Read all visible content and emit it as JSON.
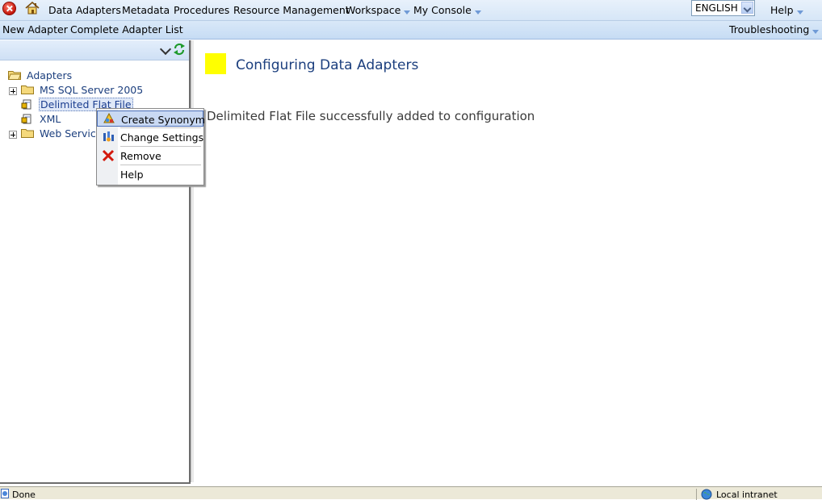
{
  "menubar": {
    "items": [
      {
        "label": "Data Adapters"
      },
      {
        "label": "Metadata"
      },
      {
        "label": "Procedures"
      },
      {
        "label": "Resource Management"
      },
      {
        "label": "Workspace"
      },
      {
        "label": "My Console"
      }
    ],
    "language": "ENGLISH",
    "help": "Help"
  },
  "subbar": {
    "new_adapter": "New Adapter",
    "complete_list": "Complete Adapter List",
    "troubleshooting": "Troubleshooting"
  },
  "tree": {
    "root": "Adapters",
    "items": [
      {
        "label": "MS SQL Server 2005"
      },
      {
        "label": "Delimited Flat File"
      },
      {
        "label": "XML"
      },
      {
        "label": "Web Services"
      }
    ]
  },
  "context_menu": {
    "items": [
      {
        "label": "Create Synonym",
        "icon": "create-synonym-icon"
      },
      {
        "label": "Change Settings",
        "icon": "settings-icon"
      },
      {
        "label": "Remove",
        "icon": "remove-x-icon"
      },
      {
        "label": "Help",
        "icon": ""
      }
    ]
  },
  "main": {
    "title": "Configuring Data Adapters",
    "message": "Delimited Flat File successfully added to configuration"
  },
  "statusbar": {
    "status": "Done",
    "zone": "Local intranet"
  },
  "colors": {
    "accent_yellow": "#ffff00",
    "title_blue": "#1c3f7e"
  }
}
